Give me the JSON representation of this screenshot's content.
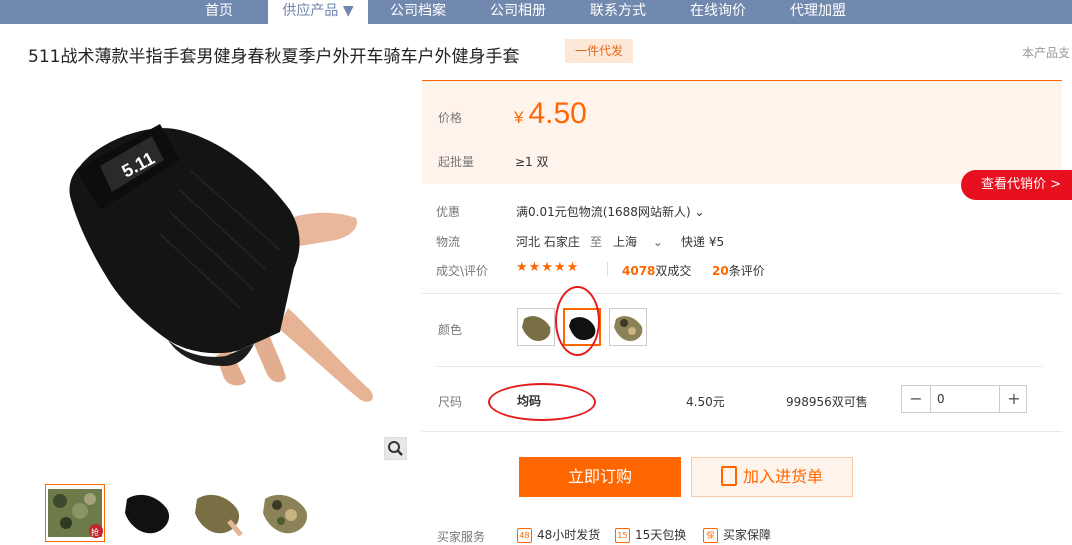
{
  "nav": {
    "items": [
      "首页",
      "供应产品 ▼",
      "公司档案",
      "公司相册",
      "联系方式",
      "在线询价",
      "代理加盟"
    ],
    "active_index": 1
  },
  "product": {
    "title": "511战术薄款半指手套男健身春秋夏季户外开车骑车户外健身手套",
    "badge": "一件代发",
    "side_note": "本产品支"
  },
  "price": {
    "label": "价格",
    "currency": "¥",
    "value": "4.50",
    "moq_label": "起批量",
    "moq_value": "≥1 双"
  },
  "proxy_button": "查看代销价 >",
  "promo": {
    "label": "优惠",
    "value": "满0.01元包物流(1688网站新人) ⌄"
  },
  "logistics": {
    "label": "物流",
    "from": "河北 石家庄",
    "to_word": "至",
    "to": "上海",
    "shipping": "快递 ¥5"
  },
  "deals": {
    "label": "成交\\评价",
    "stars": "★★★★★",
    "sold_count": "4078",
    "sold_unit": "双成交",
    "review_count": "20",
    "review_unit": "条评价"
  },
  "color": {
    "label": "颜色",
    "selected_index": 1
  },
  "size": {
    "label": "尺码",
    "value": "均码",
    "unit_price": "4.50元",
    "stock": "998956双可售",
    "qty": "0",
    "minus": "−",
    "plus": "+"
  },
  "actions": {
    "buy": "立即订购",
    "cart": "加入进货单"
  },
  "services": {
    "label": "买家服务",
    "items": [
      {
        "icon": "48",
        "text": "48小时发货"
      },
      {
        "icon": "15",
        "text": "15天包换"
      },
      {
        "icon": "保",
        "text": "买家保障"
      }
    ]
  },
  "thumb_badge": "抢",
  "colors": {
    "accent": "#ff6600",
    "nav": "#7189ae",
    "red": "#e8101e"
  }
}
